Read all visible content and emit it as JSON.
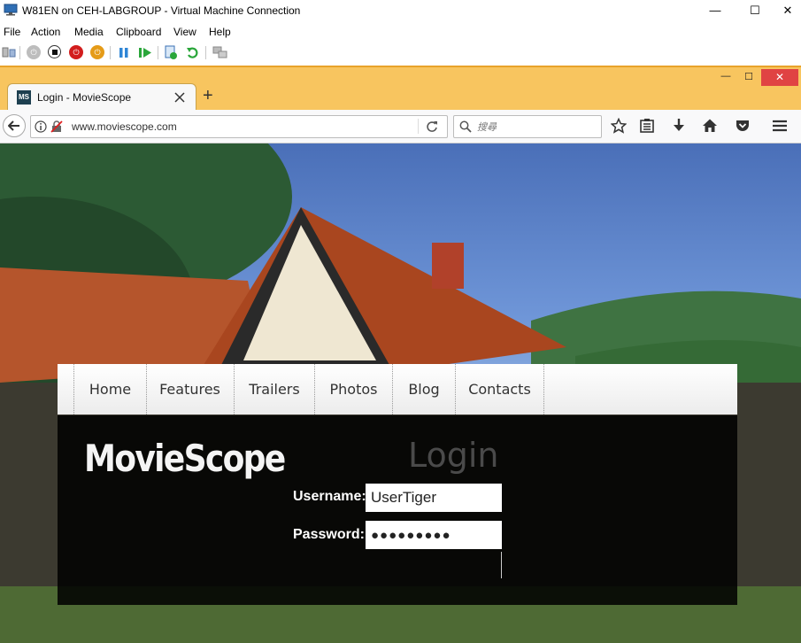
{
  "vm_window": {
    "title": "W81EN on CEH-LABGROUP - Virtual Machine Connection",
    "controls": {
      "minimize": "—",
      "maximize": "☐",
      "close": "✕"
    },
    "menu": [
      "File",
      "Action",
      "Media",
      "Clipboard",
      "View",
      "Help"
    ]
  },
  "browser": {
    "tab": {
      "favicon_text": "MS",
      "title": "Login - MovieScope"
    },
    "new_tab": "+",
    "window_controls": {
      "minimize": "—",
      "maximize": "☐",
      "close": "✕"
    },
    "url": "www.moviescope.com",
    "search_placeholder": "搜尋"
  },
  "site": {
    "logo": "MovieScope",
    "nav": [
      "Home",
      "Features",
      "Trailers",
      "Photos",
      "Blog",
      "Contacts"
    ],
    "login": {
      "heading": "Login",
      "username_label": "Username:",
      "username_value": "UserTiger",
      "password_label": "Password:",
      "password_value": "●●●●●●●●●"
    }
  },
  "colors": {
    "firefox_chrome": "#f8c55f",
    "close_button": "#e04343",
    "panel": "#000000"
  }
}
